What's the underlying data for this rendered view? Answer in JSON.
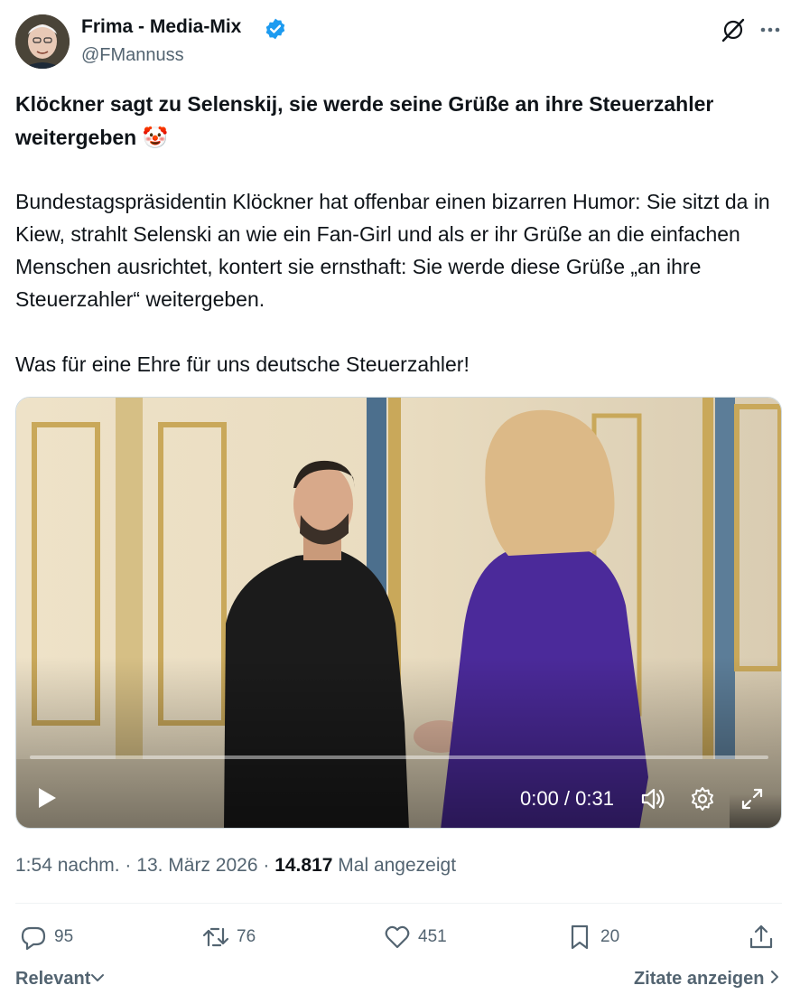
{
  "author": {
    "name": "Frima - Media-Mix",
    "handle": "@FMannuss",
    "verified": true,
    "verified_color": "#1d9bf0"
  },
  "post": {
    "title": "Klöckner sagt zu Selenskij, sie werde seine Grüße an ihre Steuerzahler weitergeben 🤡",
    "paragraph1": "Bundestagspräsidentin Klöckner hat offenbar einen bizarren Humor: Sie sitzt da in Kiew, strahlt Selenski an wie ein Fan-Girl und als er ihr Grüße an die einfachen Menschen ausrichtet, kontert sie ernsthaft: Sie werde diese Grüße „an ihre Steuerzahler“ weitergeben.",
    "paragraph2": "Was für eine Ehre für uns deutsche Steuerzahler!"
  },
  "video": {
    "time_display": "0:00 / 0:31",
    "progress": 0
  },
  "meta": {
    "time": "1:54 nachm.",
    "separator": "·",
    "date": "13. März 2026",
    "views": "14.817",
    "views_label": "Mal angezeigt"
  },
  "actions": {
    "replies": "95",
    "reposts": "76",
    "likes": "451",
    "bookmarks": "20"
  },
  "footer": {
    "sort_label": "Relevant",
    "quotes_label": "Zitate anzeigen"
  },
  "icons": [
    "grok-icon",
    "more-icon",
    "play-icon",
    "volume-icon",
    "settings-icon",
    "fullscreen-icon",
    "reply-icon",
    "repost-icon",
    "like-icon",
    "bookmark-icon",
    "share-icon",
    "chevron-down-icon",
    "chevron-right-icon"
  ]
}
